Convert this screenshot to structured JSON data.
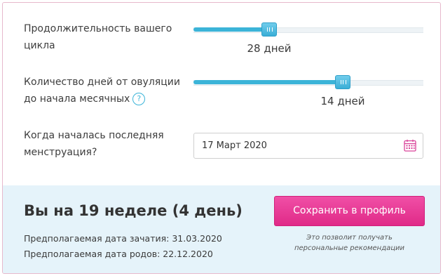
{
  "cycle": {
    "label_line1": "Продолжительность вашего",
    "label_line2": "цикла",
    "value_text": "28 дней",
    "slider_fraction": 0.33
  },
  "ovulation": {
    "label_line1": "Количество дней от овуляции",
    "label_line2": "до начала месячных",
    "help_glyph": "?",
    "value_text": "14 дней",
    "slider_fraction": 0.65
  },
  "period": {
    "label_line1": "Когда началась последняя",
    "label_line2": "менструация?",
    "date_value": "17 Март 2020",
    "icon": "calendar-icon"
  },
  "result": {
    "headline": "Вы на 19 неделе (4 день)",
    "conception": "Предполагаемая дата зачатия: 31.03.2020",
    "birth": "Предполагаемая дата родов: 22.12.2020",
    "save_label": "Сохранить в профиль",
    "note_line1": "Это позволит получать",
    "note_line2": "персональные рекомендации"
  },
  "colors": {
    "accent": "#3bb4d8",
    "button": "#e8359a",
    "result_bg": "#e5f3fa"
  }
}
